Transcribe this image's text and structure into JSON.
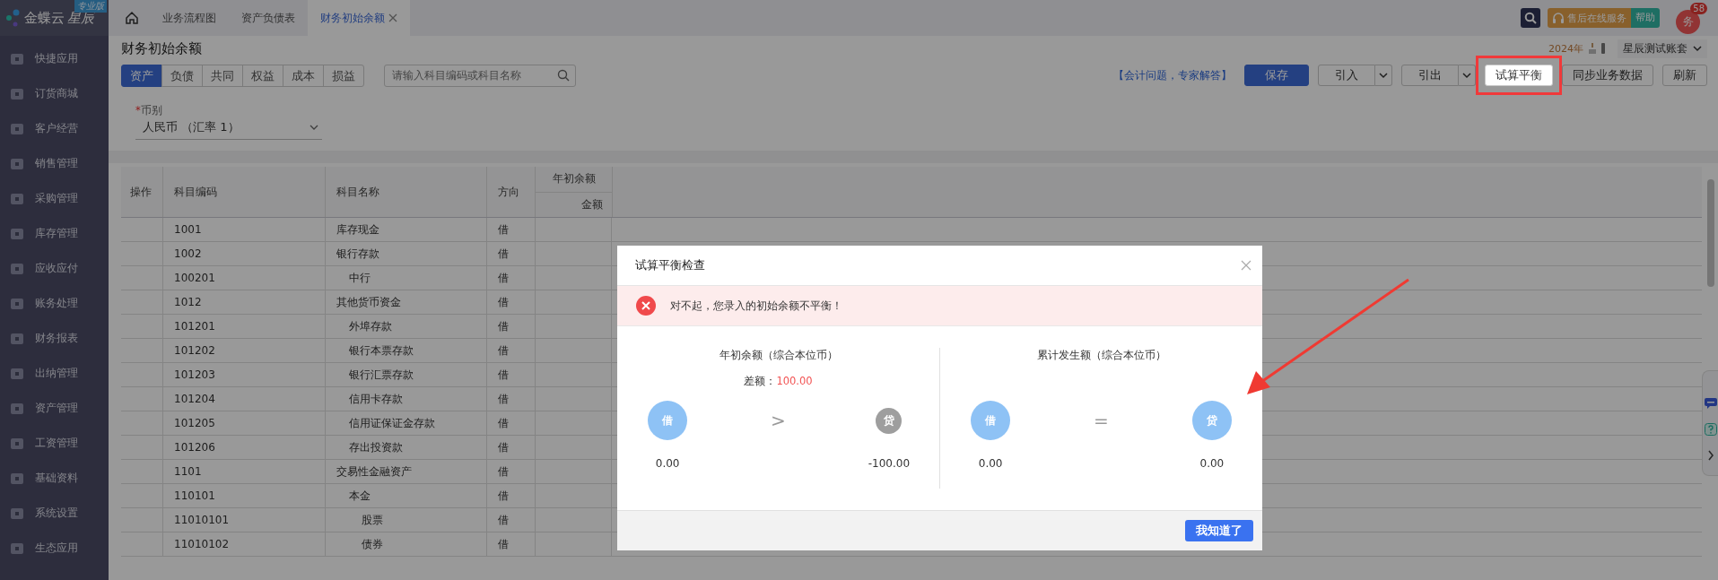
{
  "sidebar": {
    "logo": {
      "name": "金蝶云",
      "suffix": "星辰",
      "badge": "专业版"
    },
    "items": [
      {
        "label": "快捷应用"
      },
      {
        "label": "订货商城"
      },
      {
        "label": "客户经营"
      },
      {
        "label": "销售管理"
      },
      {
        "label": "采购管理"
      },
      {
        "label": "库存管理"
      },
      {
        "label": "应收应付"
      },
      {
        "label": "账务处理"
      },
      {
        "label": "财务报表"
      },
      {
        "label": "出纳管理"
      },
      {
        "label": "资产管理"
      },
      {
        "label": "工资管理"
      },
      {
        "label": "基础资料"
      },
      {
        "label": "系统设置"
      },
      {
        "label": "生态应用"
      }
    ]
  },
  "tabs": [
    {
      "label": "业务流程图",
      "selected": false,
      "closable": false
    },
    {
      "label": "资产负债表",
      "selected": false,
      "closable": false
    },
    {
      "label": "财务初始余额",
      "selected": true,
      "closable": true
    }
  ],
  "header": {
    "service": "售后在线服务",
    "help": "帮助",
    "avatar": "务",
    "badge": "58",
    "year": "2024年",
    "account": "星辰测试账套"
  },
  "page": {
    "title": "财务初始余额",
    "categories": [
      {
        "label": "资产",
        "selected": true
      },
      {
        "label": "负债",
        "selected": false
      },
      {
        "label": "共同",
        "selected": false
      },
      {
        "label": "权益",
        "selected": false
      },
      {
        "label": "成本",
        "selected": false
      },
      {
        "label": "损益",
        "selected": false
      }
    ],
    "search": {
      "placeholder": "请输入科目编码或科目名称"
    },
    "link": "【会计问题，专家解答】",
    "buttons": [
      {
        "label": "保存",
        "kind": "primary",
        "highlighted": false
      },
      {
        "label": "引入",
        "kind": "split",
        "highlighted": false
      },
      {
        "label": "引出",
        "kind": "split",
        "highlighted": false
      },
      {
        "label": "试算平衡",
        "kind": "plain",
        "highlighted": true
      },
      {
        "label": "同步业务数据",
        "kind": "plain",
        "highlighted": false
      },
      {
        "label": "刷新",
        "kind": "plain",
        "highlighted": false
      }
    ],
    "currency": {
      "required_mark": "*",
      "label": "币别",
      "value": "人民币 （汇率 1）"
    }
  },
  "table": {
    "columns": {
      "op": "操作",
      "code": "科目编码",
      "name": "科目名称",
      "direction": "方向",
      "group": "年初余额",
      "amount": "金额"
    },
    "rows": [
      {
        "code": "1001",
        "name": "库存现金",
        "direction": "借"
      },
      {
        "code": "1002",
        "name": "银行存款",
        "direction": "借",
        "children": [
          {
            "code": "100201",
            "name": "中行",
            "direction": "借"
          }
        ]
      },
      {
        "code": "1012",
        "name": "其他货币资金",
        "direction": "借",
        "children": [
          {
            "code": "101201",
            "name": "外埠存款",
            "direction": "借"
          },
          {
            "code": "101202",
            "name": "银行本票存款",
            "direction": "借"
          },
          {
            "code": "101203",
            "name": "银行汇票存款",
            "direction": "借"
          },
          {
            "code": "101204",
            "name": "信用卡存款",
            "direction": "借"
          },
          {
            "code": "101205",
            "name": "信用证保证金存款",
            "direction": "借"
          },
          {
            "code": "101206",
            "name": "存出投资款",
            "direction": "借"
          }
        ]
      },
      {
        "code": "1101",
        "name": "交易性金融资产",
        "direction": "借",
        "children": [
          {
            "code": "110101",
            "name": "本金",
            "direction": "借",
            "children": [
              {
                "code": "11010101",
                "name": "股票",
                "direction": "借"
              },
              {
                "code": "11010102",
                "name": "债券",
                "direction": "借"
              }
            ]
          }
        ]
      }
    ]
  },
  "dialog": {
    "title": "试算平衡检查",
    "alert": "对不起，您录入的初始余额不平衡！",
    "panels": [
      {
        "title": "年初余额（综合本位币）",
        "diff_label": "差额：",
        "diff_value": "100.00",
        "debit": {
          "label": "借",
          "value": "0.00",
          "active": true
        },
        "operator": ">",
        "credit": {
          "label": "贷",
          "value": "-100.00",
          "active": false
        }
      },
      {
        "title": "累计发生额（综合本位币）",
        "debit": {
          "label": "借",
          "value": "0.00",
          "active": true
        },
        "operator": "=",
        "credit": {
          "label": "贷",
          "value": "0.00",
          "active": true
        }
      }
    ],
    "button": "我知道了"
  },
  "annotations": [
    {
      "kind": "arrow"
    }
  ]
}
